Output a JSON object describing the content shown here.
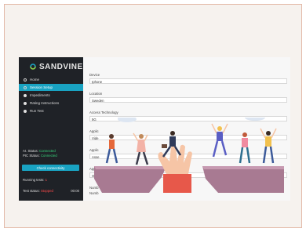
{
  "sidebar": {
    "logo_text": "SANDVINE",
    "items": [
      {
        "label": "Home",
        "icon": "home-icon"
      },
      {
        "label": "Session Setup",
        "icon": "gear-icon"
      },
      {
        "label": "Impediments",
        "icon": "warning-icon"
      },
      {
        "label": "Rating Instructions",
        "icon": "info-icon"
      },
      {
        "label": "Run Test",
        "icon": "play-icon"
      }
    ],
    "ai_status_label": "AI. Status:",
    "ai_status_value": "Connected",
    "pc_status_label": "PIC Status:",
    "pc_status_value": "Connected",
    "check_button": "Check connectivity",
    "running_label": "Running tests:",
    "running_count": "1",
    "test_status_label": "Test status:",
    "test_status_value": "Stopped",
    "test_time": "00:00"
  },
  "form": {
    "device_label": "Device",
    "device_value": "Iphone",
    "location_label": "Location",
    "location_value": "Sweden",
    "access_label": "Access Technology",
    "access_value": "5G",
    "app1_label": "Applic",
    "app1_value": "Vide",
    "app2_label": "Applic",
    "app2_value": "Asse",
    "app3_label": "Applic",
    "app3_value": "On",
    "num1_label": "Numb",
    "num2_label": "Numb"
  },
  "colors": {
    "accent": "#19a3c2",
    "sidebar_bg": "#1f2227",
    "ok": "#37d27a",
    "error": "#ff4a4a",
    "cliff": "#a87a92"
  }
}
